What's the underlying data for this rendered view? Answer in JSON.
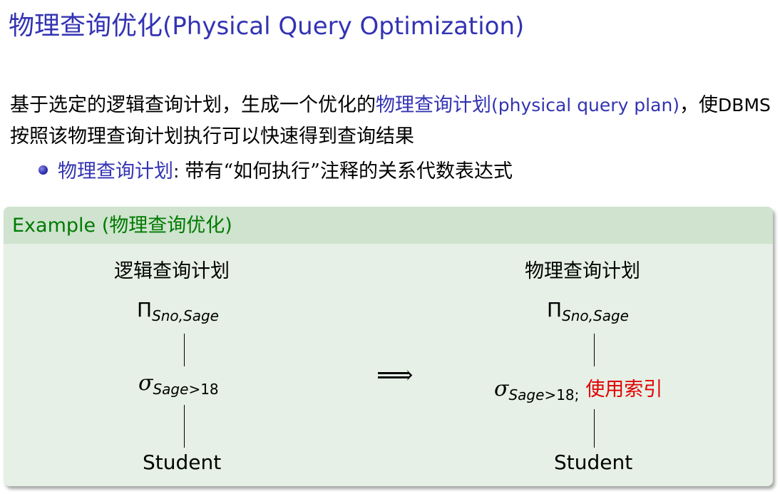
{
  "slide": {
    "title_cjk": "物理查询优化",
    "title_en": "(Physical Query Optimization)"
  },
  "paragraph": {
    "part1": "基于选定的逻辑查询计划，生成一个优化的",
    "term_cjk": "物理查询计划",
    "term_en": "(physical query plan)",
    "part2": "，使",
    "dbms": "DBMS",
    "part3": "按照该物理查询计划执行可以快速得到查询结果"
  },
  "bullet": {
    "term": "物理查询计划",
    "colon": ": ",
    "text_before": "带有",
    "quote": "“如何执行”",
    "text_after": "注释的关系代数表达式"
  },
  "example": {
    "title_en": "Example (",
    "title_cjk": "物理查询优化",
    "title_close": ")",
    "logical_label": "逻辑查询计划",
    "physical_label": "物理查询计划",
    "projection_symbol": "Π",
    "projection_attrs": "Sno,Sage",
    "selection_symbol": "σ",
    "selection_attr": "Sage",
    "selection_cond": ">18",
    "relation": "Student",
    "arrow": "⟹",
    "semicolon": ";",
    "physical_note": "使用索引"
  }
}
